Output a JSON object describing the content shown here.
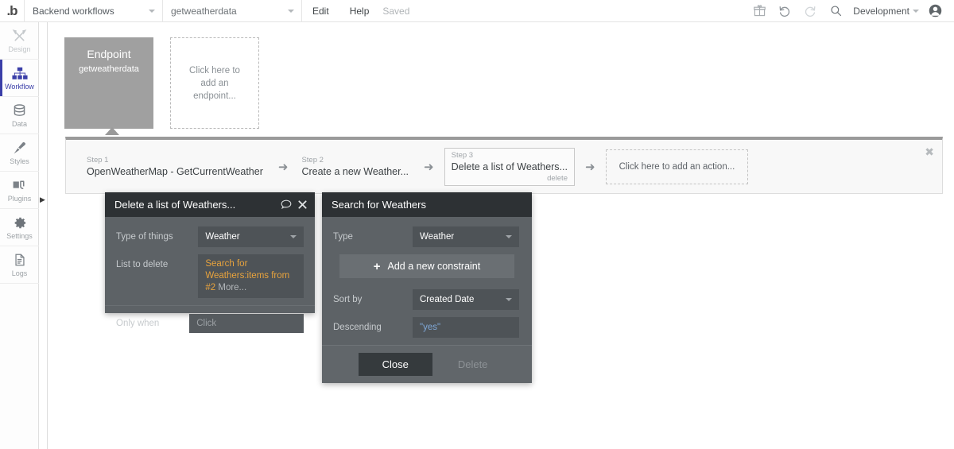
{
  "topbar": {
    "logo": "b-logo-icon",
    "app_selector": "Backend workflows",
    "page_selector": "getweatherdata",
    "edit": "Edit",
    "help": "Help",
    "status": "Saved",
    "icons": [
      "gift-icon",
      "undo-icon",
      "redo-icon",
      "search-icon"
    ],
    "version": "Development",
    "account": "account-avatar-icon"
  },
  "sidebar": {
    "items": [
      {
        "label": "Design",
        "icon": "design-tools-icon",
        "active": false,
        "muted": true
      },
      {
        "label": "Workflow",
        "icon": "workflow-tree-icon",
        "active": true,
        "muted": false
      },
      {
        "label": "Data",
        "icon": "database-icon",
        "active": false,
        "muted": false
      },
      {
        "label": "Styles",
        "icon": "paintbrush-icon",
        "active": false,
        "muted": false
      },
      {
        "label": "Plugins",
        "icon": "plug-icon",
        "active": false,
        "muted": false
      },
      {
        "label": "Settings",
        "icon": "gear-icon",
        "active": false,
        "muted": false
      },
      {
        "label": "Logs",
        "icon": "document-icon",
        "active": false,
        "muted": false
      }
    ],
    "expand_icon": "expand-sidebar-arrow-icon"
  },
  "endpoint": {
    "title": "Endpoint",
    "name": "getweatherdata",
    "add_placeholder": "Click here to add an endpoint..."
  },
  "steps": {
    "close_icon": "close-icon",
    "list": [
      {
        "num": "Step 1",
        "name": "OpenWeatherMap - GetCurrentWeather",
        "sub": "",
        "selected": false
      },
      {
        "num": "Step 2",
        "name": "Create a new Weather...",
        "sub": "",
        "selected": false
      },
      {
        "num": "Step 3",
        "name": "Delete a list of Weathers...",
        "sub": "delete",
        "selected": true
      }
    ],
    "add_placeholder": "Click here to add an action...",
    "arrow_icon": "arrow-right-icon"
  },
  "panel_delete": {
    "title": "Delete a list of Weathers...",
    "comment_icon": "comment-bubble-icon",
    "close_icon": "close-icon",
    "rows": [
      {
        "label": "Type of things",
        "value": "Weather",
        "type": "dropdown"
      }
    ],
    "list_to_delete": {
      "label": "List to delete",
      "value": "Search for Weathers:items from #2",
      "more": "More..."
    },
    "only_when": {
      "label": "Only when",
      "placeholder": "Click"
    }
  },
  "panel_search": {
    "title": "Search for Weathers",
    "type_row": {
      "label": "Type",
      "value": "Weather"
    },
    "constraint_btn": {
      "plus": "+",
      "label": "Add a new constraint"
    },
    "sort_row": {
      "label": "Sort by",
      "value": "Created Date"
    },
    "descending_row": {
      "label": "Descending",
      "value": "\"yes\""
    },
    "footer": {
      "close": "Close",
      "delete": "Delete"
    }
  },
  "colors": {
    "accent_blue": "#3b3fa8",
    "panel_bg": "#5d6266",
    "panel_header": "#2d3134",
    "orange_value": "#e8a33d",
    "blue_value": "#7fa8d8",
    "endpoint_gray": "#a0a0a0"
  }
}
